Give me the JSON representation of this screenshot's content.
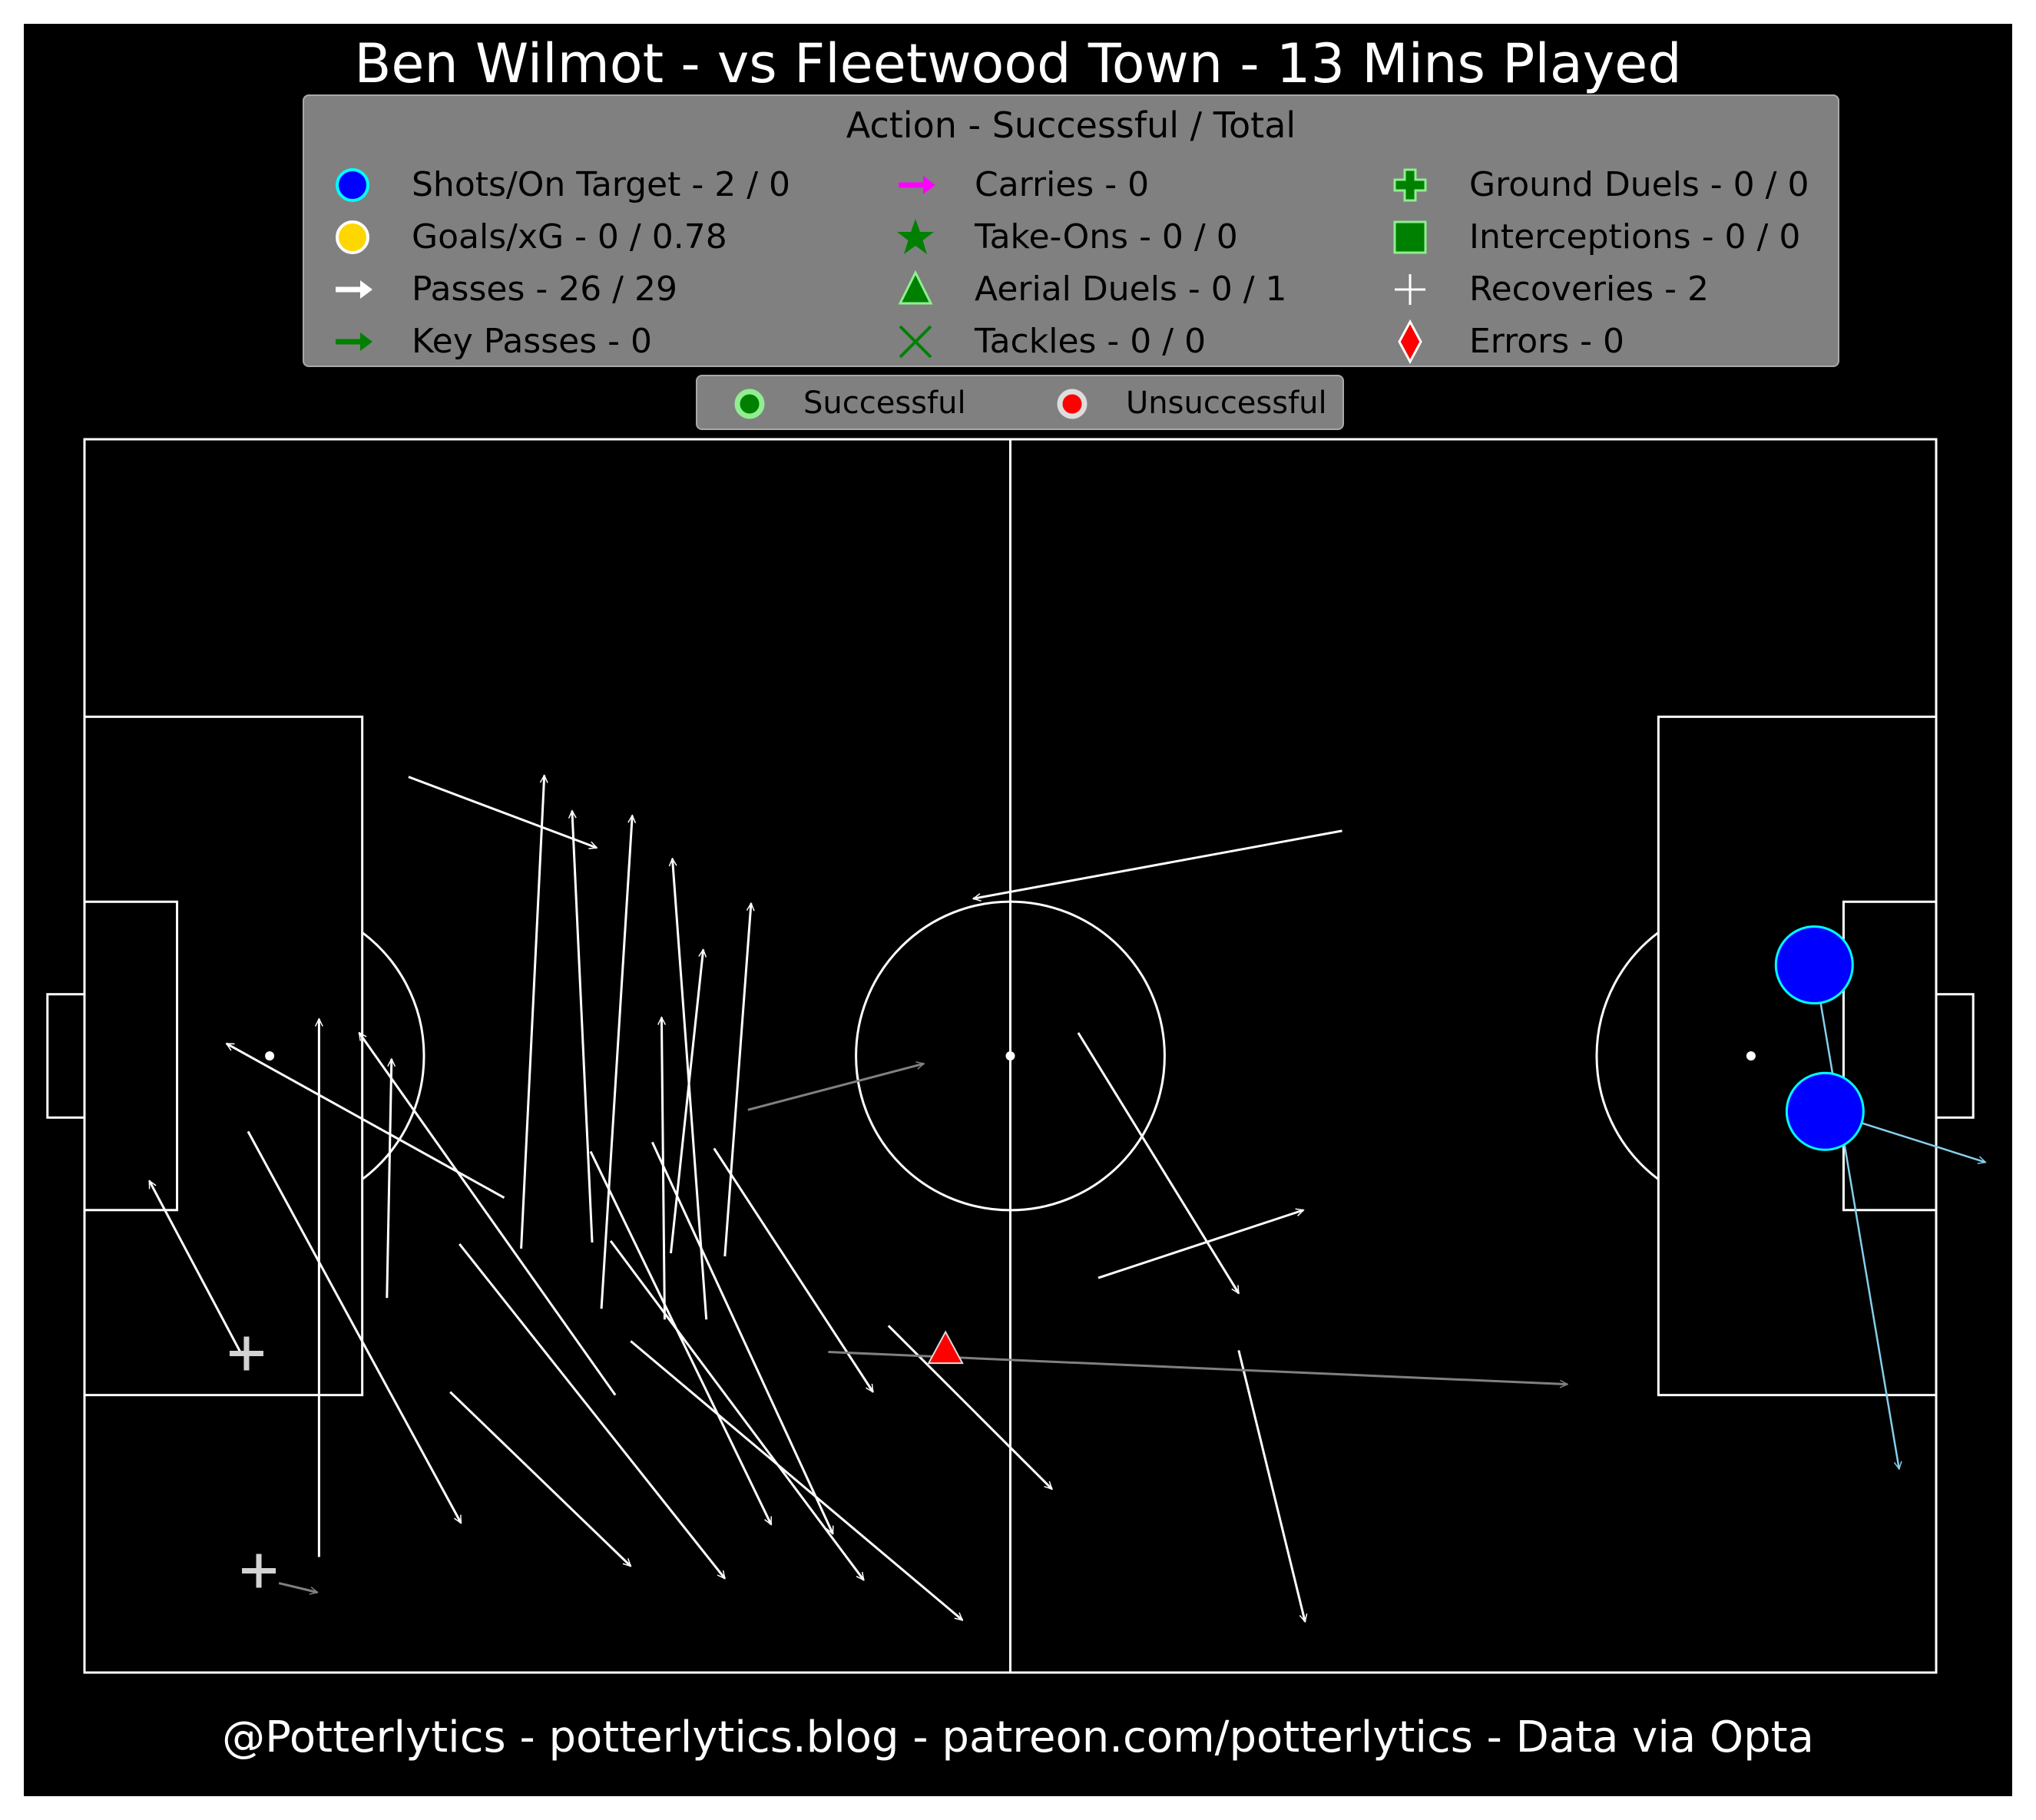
{
  "title": "Ben Wilmot - vs Fleetwood Town - 13 Mins Played",
  "footer": "@Potterlytics - potterlytics.blog - patreon.com/potterlytics - Data via Opta",
  "legend": {
    "title": "Action - Successful / Total",
    "items": [
      {
        "label": "Shots/On Target - 2 / 0",
        "icon": "circle-blue",
        "color": "#0000ff"
      },
      {
        "label": "Goals/xG - 0 / 0.78",
        "icon": "circle-gold",
        "color": "#ffd700"
      },
      {
        "label": "Passes - 26 / 29",
        "icon": "arrow-white",
        "color": "#ffffff"
      },
      {
        "label": "Key Passes - 0",
        "icon": "arrow-green",
        "color": "#008000"
      },
      {
        "label": "Carries - 0",
        "icon": "arrow-magenta",
        "color": "#ff00ff"
      },
      {
        "label": "Take-Ons - 0 / 0",
        "icon": "star-green",
        "color": "#008000"
      },
      {
        "label": "Aerial Duels - 0 / 1",
        "icon": "triangle-green",
        "color": "#008000"
      },
      {
        "label": "Tackles - 0 / 0",
        "icon": "x-green",
        "color": "#008000"
      },
      {
        "label": "Ground Duels - 0 / 0",
        "icon": "plus-green",
        "color": "#008000"
      },
      {
        "label": "Interceptions - 0 / 0",
        "icon": "square-green",
        "color": "#008000"
      },
      {
        "label": "Recoveries - 2",
        "icon": "plus-white",
        "color": "#ffffff"
      },
      {
        "label": "Errors - 0",
        "icon": "diamond-red",
        "color": "#ff0000"
      }
    ]
  },
  "outcome_legend": {
    "successful": "Successful",
    "unsuccessful": "Unsuccessful",
    "successful_color": "#90ee90",
    "unsuccessful_color": "#ff0000"
  },
  "colors": {
    "background": "#000000",
    "pitch_lines": "#ffffff",
    "pass_successful": "#ffffff",
    "pass_unsuccessful": "#808080",
    "shot_fill": "#0000ff",
    "shot_edge": "#00ffff",
    "shot_line": "#87ceeb",
    "aerial_unsuccessful": "#ff0000"
  },
  "chart_data": {
    "type": "scatter",
    "pitch": {
      "length": 120,
      "width": 80
    },
    "passes": [
      {
        "x1": 21.0,
        "y1": 21.9,
        "x2": 33.2,
        "y2": 26.5,
        "outcome": "successful"
      },
      {
        "x1": 28.3,
        "y1": 52.5,
        "x2": 29.8,
        "y2": 21.8,
        "outcome": "successful"
      },
      {
        "x1": 32.9,
        "y1": 52.1,
        "x2": 31.6,
        "y2": 24.1,
        "outcome": "successful"
      },
      {
        "x1": 33.5,
        "y1": 56.4,
        "x2": 35.5,
        "y2": 24.4,
        "outcome": "successful"
      },
      {
        "x1": 40.3,
        "y1": 57.1,
        "x2": 38.1,
        "y2": 27.2,
        "outcome": "successful"
      },
      {
        "x1": 38.0,
        "y1": 52.8,
        "x2": 40.1,
        "y2": 33.1,
        "outcome": "successful"
      },
      {
        "x1": 41.5,
        "y1": 53.0,
        "x2": 43.2,
        "y2": 30.1,
        "outcome": "successful"
      },
      {
        "x1": 37.6,
        "y1": 57.1,
        "x2": 37.4,
        "y2": 37.5,
        "outcome": "successful"
      },
      {
        "x1": 27.2,
        "y1": 49.2,
        "x2": 9.2,
        "y2": 39.2,
        "outcome": "successful"
      },
      {
        "x1": 19.6,
        "y1": 55.7,
        "x2": 19.9,
        "y2": 40.2,
        "outcome": "successful"
      },
      {
        "x1": 34.4,
        "y1": 62.0,
        "x2": 17.8,
        "y2": 38.5,
        "outcome": "successful"
      },
      {
        "x1": 15.2,
        "y1": 72.5,
        "x2": 15.2,
        "y2": 37.6,
        "outcome": "successful"
      },
      {
        "x1": 10.6,
        "y1": 44.9,
        "x2": 24.4,
        "y2": 70.3,
        "outcome": "successful"
      },
      {
        "x1": 10.2,
        "y1": 59.4,
        "x2": 4.2,
        "y2": 48.1,
        "outcome": "successful"
      },
      {
        "x1": 24.3,
        "y1": 52.2,
        "x2": 41.5,
        "y2": 73.9,
        "outcome": "successful"
      },
      {
        "x1": 23.7,
        "y1": 61.8,
        "x2": 35.4,
        "y2": 73.1,
        "outcome": "successful"
      },
      {
        "x1": 32.8,
        "y1": 46.2,
        "x2": 44.5,
        "y2": 70.4,
        "outcome": "successful"
      },
      {
        "x1": 36.8,
        "y1": 45.6,
        "x2": 48.5,
        "y2": 71.0,
        "outcome": "successful"
      },
      {
        "x1": 35.4,
        "y1": 58.5,
        "x2": 56.9,
        "y2": 76.6,
        "outcome": "successful"
      },
      {
        "x1": 34.1,
        "y1": 52.0,
        "x2": 50.5,
        "y2": 74.0,
        "outcome": "successful"
      },
      {
        "x1": 40.8,
        "y1": 46.0,
        "x2": 51.1,
        "y2": 61.8,
        "outcome": "successful"
      },
      {
        "x1": 52.1,
        "y1": 57.5,
        "x2": 62.7,
        "y2": 68.1,
        "outcome": "successful"
      },
      {
        "x1": 64.4,
        "y1": 38.5,
        "x2": 74.8,
        "y2": 55.4,
        "outcome": "successful"
      },
      {
        "x1": 65.7,
        "y1": 54.4,
        "x2": 79.0,
        "y2": 50.0,
        "outcome": "successful"
      },
      {
        "x1": 74.8,
        "y1": 59.1,
        "x2": 79.1,
        "y2": 76.7,
        "outcome": "successful"
      },
      {
        "x1": 81.5,
        "y1": 25.4,
        "x2": 57.6,
        "y2": 29.8,
        "outcome": "successful"
      },
      {
        "x1": 43.0,
        "y1": 43.5,
        "x2": 54.4,
        "y2": 40.5,
        "outcome": "unsuccessful"
      },
      {
        "x1": 48.2,
        "y1": 59.2,
        "x2": 96.1,
        "y2": 61.3,
        "outcome": "unsuccessful"
      },
      {
        "x1": 12.6,
        "y1": 74.2,
        "x2": 15.1,
        "y2": 74.8,
        "outcome": "unsuccessful"
      }
    ],
    "shots": [
      {
        "x": 112.1,
        "y": 34.1,
        "ex": 117.6,
        "ey": 66.8
      },
      {
        "x": 112.8,
        "y": 43.6,
        "ex": 123.2,
        "ey": 46.9
      }
    ],
    "aerial_duels": [
      {
        "x": 55.8,
        "y": 59.0,
        "outcome": "unsuccessful"
      }
    ],
    "recoveries": [
      {
        "x": 10.5,
        "y": 59.3
      },
      {
        "x": 11.3,
        "y": 73.4
      }
    ]
  }
}
